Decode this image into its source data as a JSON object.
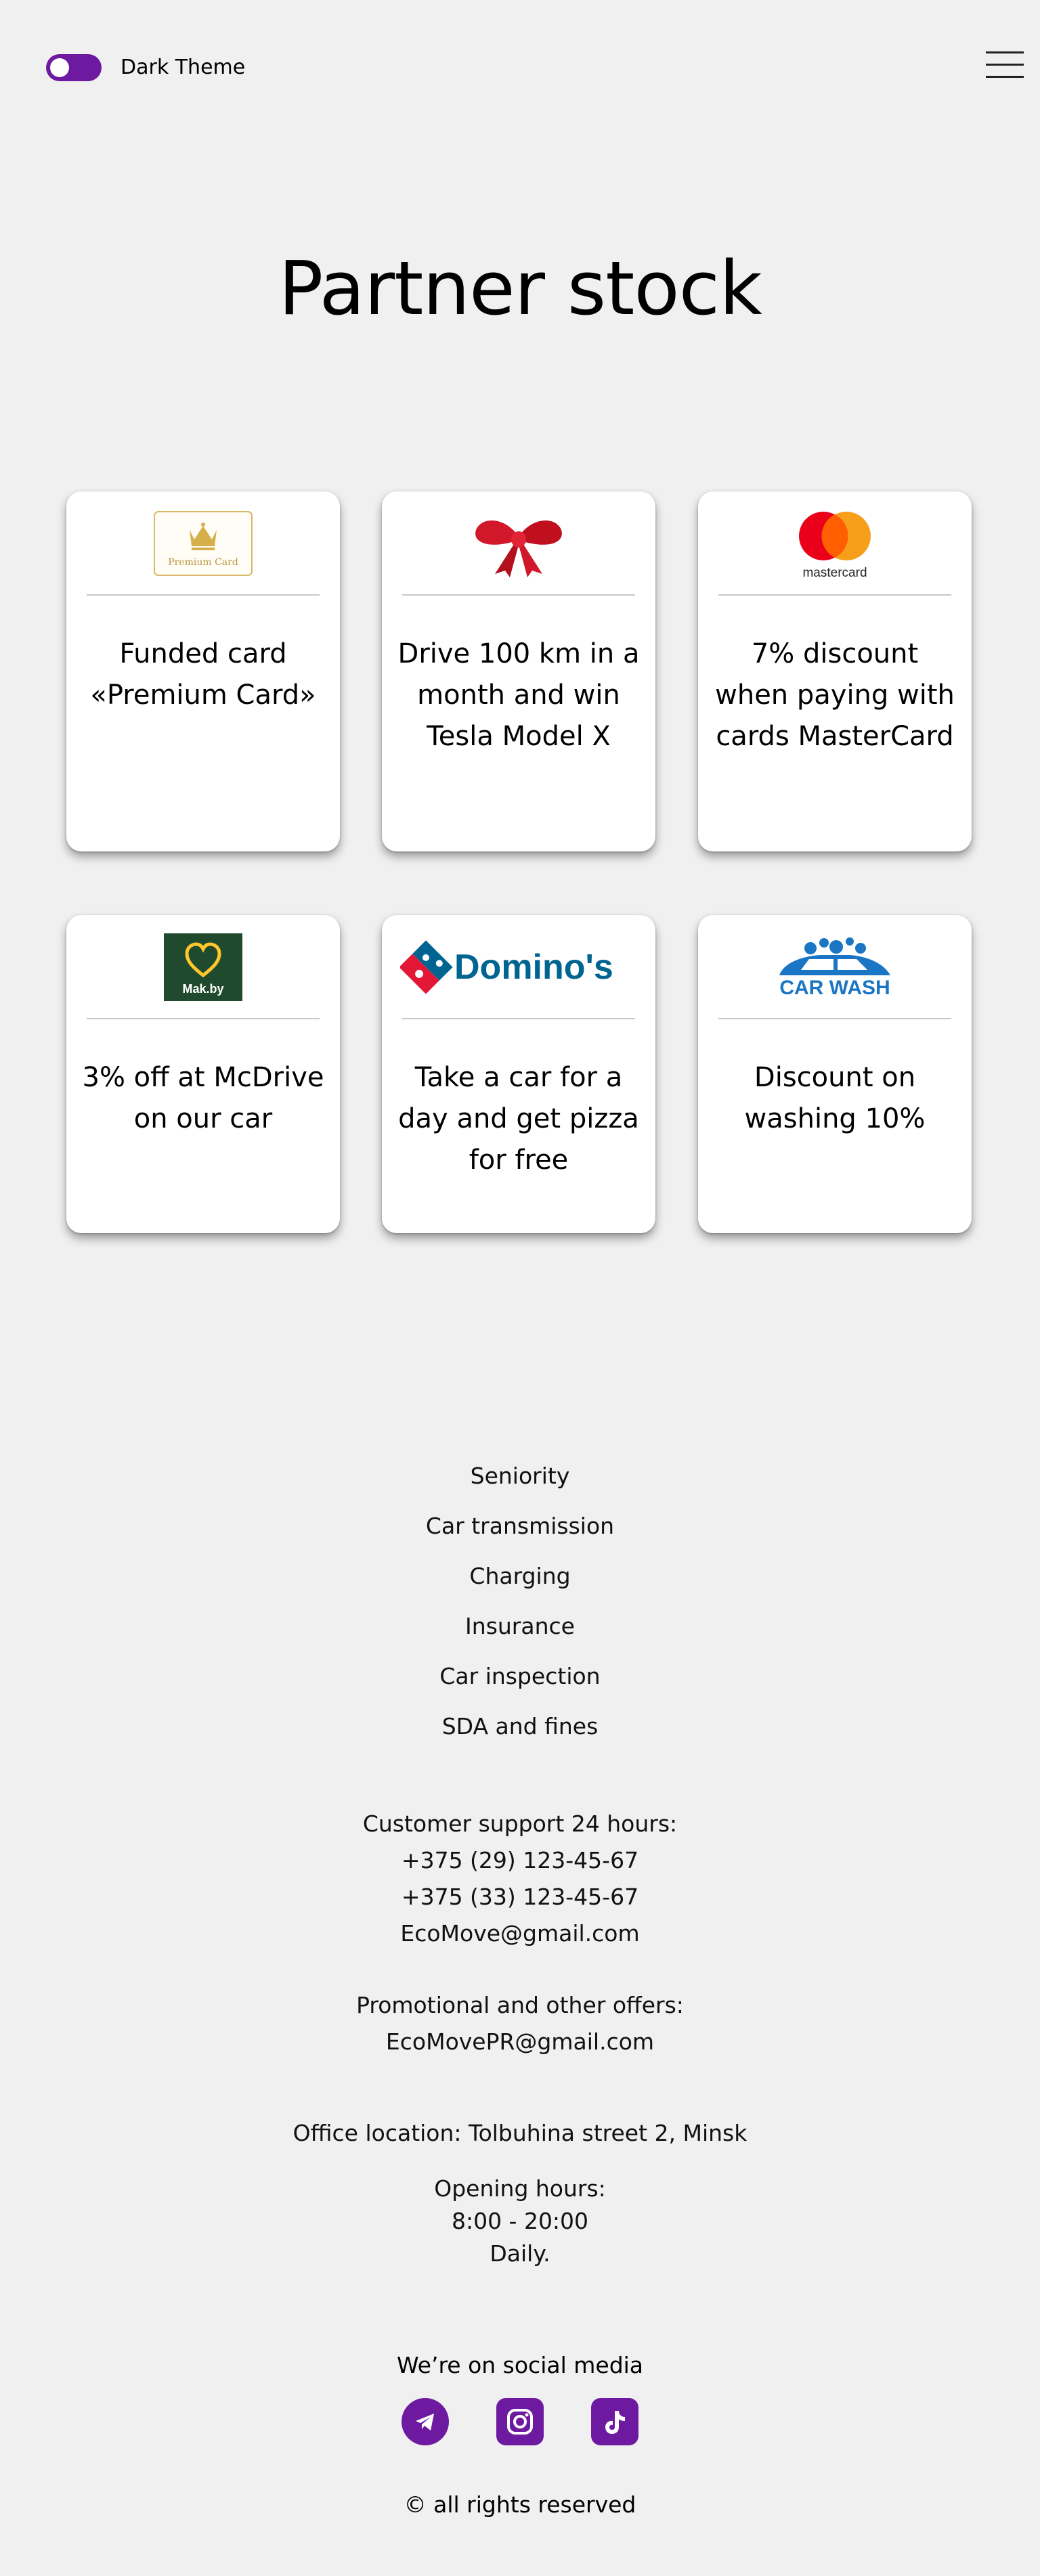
{
  "header": {
    "theme_toggle_label": "Dark Theme",
    "accent_color": "#6e1aa0"
  },
  "page_title": "Partner stock",
  "offers": [
    {
      "logo": "Premium Card",
      "text": "Funded card «Premium Card»"
    },
    {
      "logo": "red-bow",
      "text": "Drive 100 km in a month and win Tesla Model X"
    },
    {
      "logo": "mastercard",
      "text": "7% discount when paying with cards MasterCard"
    },
    {
      "logo": "Mak.by",
      "text": "3% off at McDrive on our car"
    },
    {
      "logo": "Domino's",
      "text": "Take a car for a day and get pizza for free"
    },
    {
      "logo": "CAR WASH",
      "text": "Discount on washing 10%"
    }
  ],
  "footer": {
    "nav": [
      "Seniority",
      "Car transmission",
      "Charging",
      "Insurance",
      "Car inspection",
      "SDA and fines"
    ],
    "support": {
      "title": "Customer support 24 hours:",
      "phone1": "+375 (29) 123-45-67",
      "phone2": "+375 (33) 123-45-67",
      "email": "EcoMove@gmail.com"
    },
    "promo": {
      "title": "Promotional and other offers:",
      "email": "EcoMovePR@gmail.com"
    },
    "office": "Office location: Tolbuhina street 2, Minsk",
    "hours": {
      "title": "Opening hours:",
      "time": "8:00 - 20:00",
      "days": "Daily."
    },
    "social_title": "We’re on social media",
    "social_icons": [
      "telegram-icon",
      "instagram-icon",
      "tiktok-icon"
    ],
    "copyright": "© all rights reserved"
  }
}
